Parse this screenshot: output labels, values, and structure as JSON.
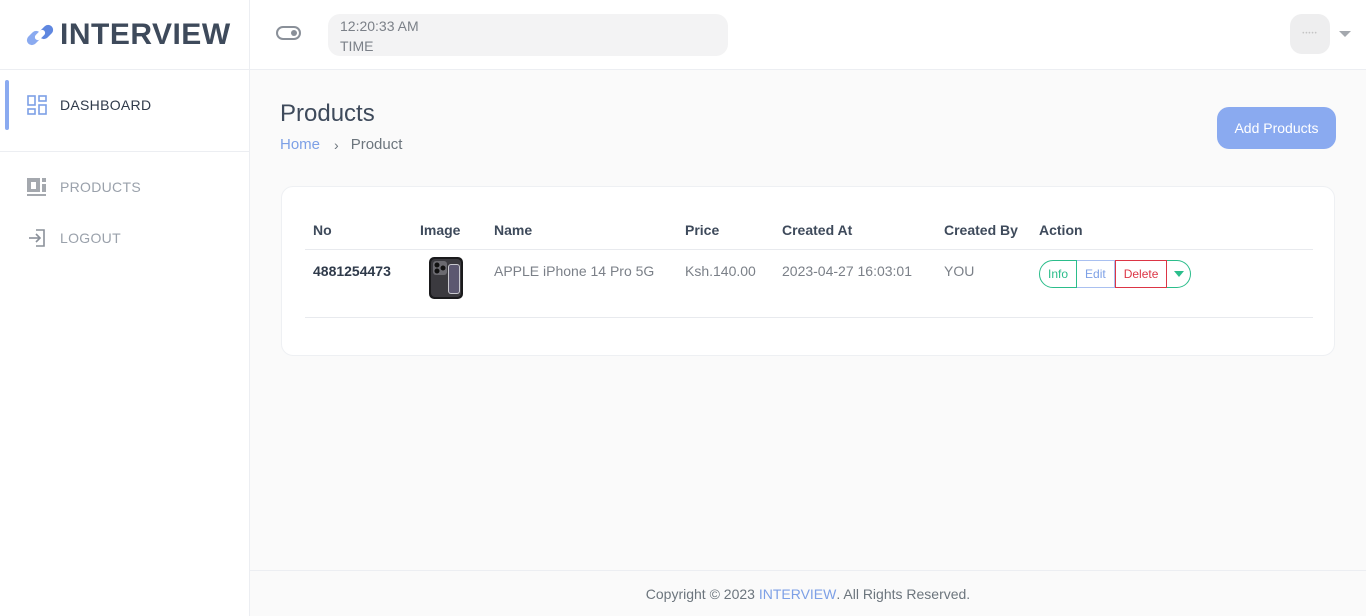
{
  "brand": {
    "name": "INTERVIEW"
  },
  "sidebar": {
    "items": [
      {
        "label": "DASHBOARD",
        "icon": "dashboard-grid-icon"
      },
      {
        "label": "PRODUCTS",
        "icon": "products-icon"
      },
      {
        "label": "LOGOUT",
        "icon": "logout-icon"
      }
    ]
  },
  "header": {
    "time": "12:20:33 AM",
    "time_label": "TIME"
  },
  "page": {
    "title": "Products",
    "breadcrumb": {
      "home": "Home",
      "separator": "›",
      "current": "Product"
    },
    "add_button": "Add Products"
  },
  "table": {
    "headers": [
      "No",
      "Image",
      "Name",
      "Price",
      "Created At",
      "Created By",
      "Action"
    ],
    "rows": [
      {
        "no": "4881254473",
        "image": "iphone-product-image",
        "name": "APPLE iPhone 14 Pro 5G",
        "price": "Ksh.140.00",
        "created_at": "2023-04-27 16:03:01",
        "created_by": "YOU",
        "actions": {
          "info": "Info",
          "edit": "Edit",
          "delete": "Delete"
        }
      }
    ]
  },
  "footer": {
    "prefix": "Copyright © 2023 ",
    "brand": "INTERVIEW",
    "suffix": ". All Rights Reserved."
  },
  "colors": {
    "accent": "#8aaaf0",
    "link": "#7da0e6",
    "success": "#2bbd8b",
    "danger": "#dc3545",
    "heading": "#3e4a5b"
  }
}
